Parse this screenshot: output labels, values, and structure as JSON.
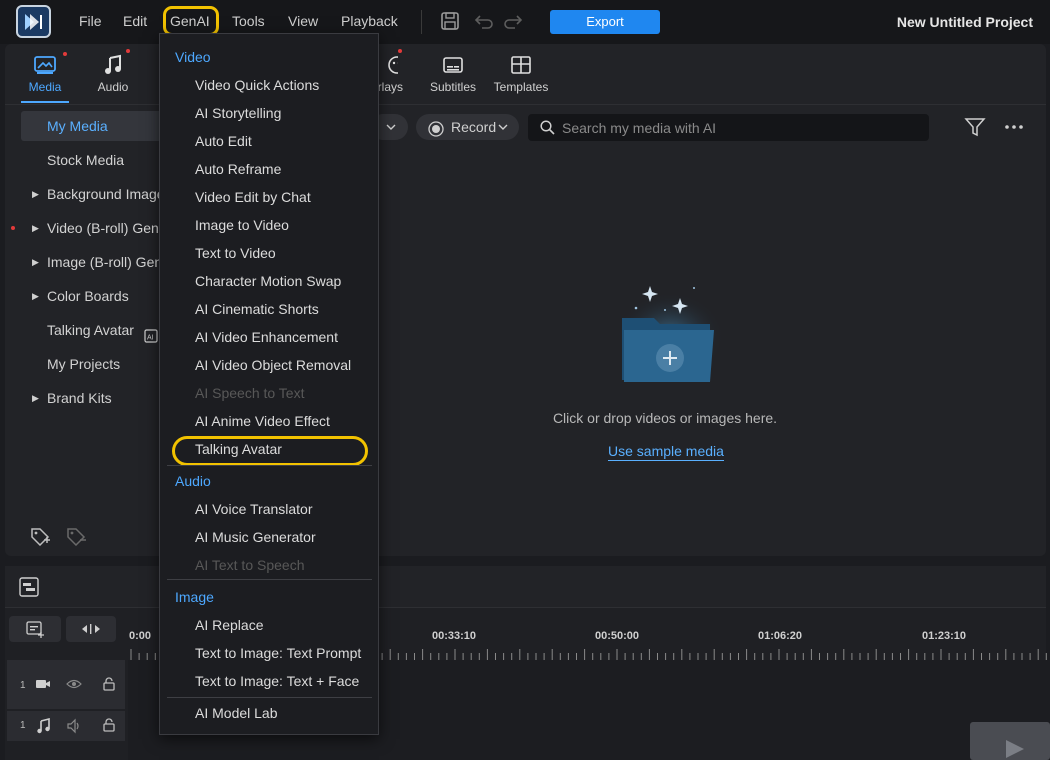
{
  "menubar": {
    "items": [
      "File",
      "Edit",
      "GenAI",
      "Tools",
      "View",
      "Playback"
    ],
    "export_label": "Export",
    "project_title": "New Untitled Project"
  },
  "tabs": [
    {
      "label": "Media",
      "active": true,
      "icon": "media-icon"
    },
    {
      "label": "Audio",
      "icon": "music-note-icon"
    },
    {
      "label": "erlays",
      "icon": "overlays-icon"
    },
    {
      "label": "Subtitles",
      "icon": "subtitles-icon"
    },
    {
      "label": "Templates",
      "icon": "templates-icon"
    }
  ],
  "sidebar": {
    "items": [
      {
        "label": "My Media",
        "active": true
      },
      {
        "label": "Stock Media"
      },
      {
        "label": "Background Images",
        "expandable": true
      },
      {
        "label": "Video (B-roll) Generator",
        "expandable": true
      },
      {
        "label": "Image (B-roll) Generator",
        "expandable": true
      },
      {
        "label": "Color Boards",
        "expandable": true
      },
      {
        "label": "Talking Avatar"
      },
      {
        "label": "My Projects"
      },
      {
        "label": "Brand Kits",
        "expandable": true
      }
    ]
  },
  "browser": {
    "record_label": "Record",
    "search_placeholder": "Search my media with AI",
    "empty_text": "Click or drop videos or images here.",
    "sample_link": "Use sample media"
  },
  "timeline": {
    "times": [
      "0:00",
      "00:33:10",
      "00:50:00",
      "01:06:20",
      "01:23:10"
    ],
    "track_numbers": [
      "1",
      "1"
    ]
  },
  "genai_menu": {
    "sections": [
      {
        "title": "Video",
        "items": [
          {
            "label": "Video Quick Actions"
          },
          {
            "label": "AI Storytelling"
          },
          {
            "label": "Auto Edit"
          },
          {
            "label": "Auto Reframe"
          },
          {
            "label": "Video Edit by Chat"
          },
          {
            "label": "Image to Video"
          },
          {
            "label": "Text to Video"
          },
          {
            "label": "Character Motion Swap"
          },
          {
            "label": "AI Cinematic Shorts"
          },
          {
            "label": "AI Video Enhancement"
          },
          {
            "label": "AI Video Object Removal"
          },
          {
            "label": "AI Speech to Text",
            "disabled": true
          },
          {
            "label": "AI Anime Video Effect"
          },
          {
            "label": "Talking Avatar",
            "highlighted": true
          }
        ]
      },
      {
        "title": "Audio",
        "items": [
          {
            "label": "AI Voice Translator"
          },
          {
            "label": "AI Music Generator"
          },
          {
            "label": "AI Text to Speech",
            "disabled": true
          }
        ]
      },
      {
        "title": "Image",
        "items": [
          {
            "label": "AI Replace"
          },
          {
            "label": "Text to Image: Text Prompt"
          },
          {
            "label": "Text to Image: Text + Face"
          }
        ]
      }
    ],
    "footer_item": "AI Model Lab"
  },
  "colors": {
    "accent": "#1f87f0",
    "link": "#4da8ff",
    "highlight": "#f2c200",
    "background": "#1b1c20"
  }
}
